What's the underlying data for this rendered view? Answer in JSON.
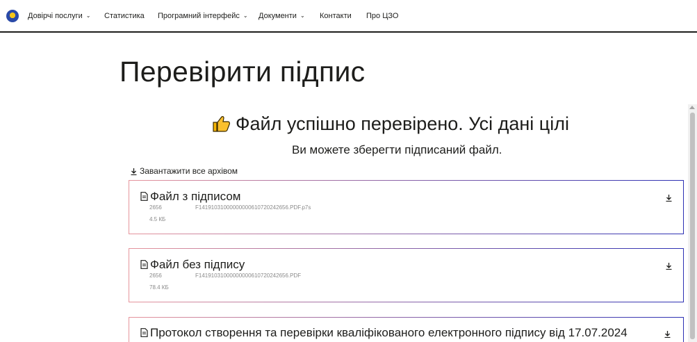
{
  "nav": {
    "items": [
      {
        "label": "Довірчі послуги",
        "dropdown": true
      },
      {
        "label": "Статистика",
        "dropdown": false
      },
      {
        "label": "Програмний інтерфейс",
        "dropdown": true
      },
      {
        "label": "Документи",
        "dropdown": true
      },
      {
        "label": "Контакти",
        "dropdown": false
      },
      {
        "label": "Про ЦЗО",
        "dropdown": false
      }
    ]
  },
  "page": {
    "title": "Перевірити підпис",
    "success_title": "Файл успішно перевірено. Усі дані цілі",
    "subtitle": "Ви можете зберегти підписаний файл.",
    "download_all": "Завантажити все архівом"
  },
  "files": [
    {
      "name": "Файл з підписом",
      "id": "2656",
      "filename": "F14191031000000000610720242656.PDF.p7s",
      "size": "4.5 КБ"
    },
    {
      "name": "Файл без підпису",
      "id": "2656",
      "filename": "F14191031000000000610720242656.PDF",
      "size": "78.4 КБ"
    },
    {
      "name": "Протокол створення та перевірки кваліфікованого електронного підпису від 17.07.2024",
      "id": "",
      "filename": "",
      "size": ""
    }
  ],
  "colors": {
    "text": "#1d1d1b",
    "card_border_start": "#e6949c",
    "card_border_end": "#2b2fb3",
    "muted": "#8a8a8a"
  },
  "icons": {
    "logo": "emblem-logo-icon",
    "success": "thumbs-up-icon",
    "download": "download-icon",
    "file": "document-icon"
  }
}
